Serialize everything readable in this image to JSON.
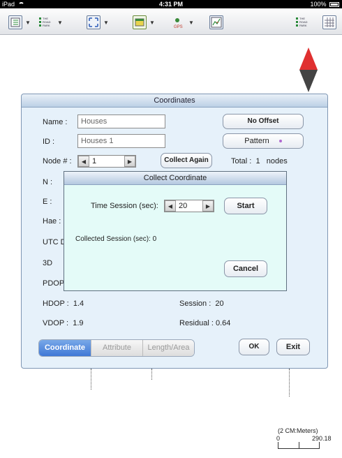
{
  "status": {
    "device": "iPad",
    "time": "4:31 PM",
    "battery": "100%"
  },
  "toolbar": {
    "mini_lines": [
      "THE",
      "ROAD",
      "PARK"
    ]
  },
  "dialog": {
    "title": "Coordinates",
    "name_label": "Name :",
    "name_value": "Houses",
    "id_label": "ID :",
    "id_value": "Houses 1",
    "node_label": "Node # :",
    "node_value": "1",
    "no_offset_button": "No Offset",
    "pattern_button": "Pattern",
    "collect_again_button": "Collect Again",
    "total_label": "Total :",
    "total_value": "1",
    "total_unit": "nodes",
    "n_label": "N :",
    "e_label": "E :",
    "hae_label": "Hae :",
    "utc_label": "UTC D",
    "threed_label": "3D",
    "pdop_label": "PDOP",
    "hdop_label": "HDOP :",
    "hdop_value": "1.4",
    "vdop_label": "VDOP :",
    "vdop_value": "1.9",
    "session_label": "Session :",
    "session_value": "20",
    "residual_label": "Residual :",
    "residual_value": "0.64",
    "tabs": [
      "Coordinate",
      "Attribute",
      "Length/Area"
    ],
    "ok_button": "OK",
    "exit_button": "Exit"
  },
  "modal": {
    "title": "Collect Coordinate",
    "time_session_label": "Time Session (sec):",
    "time_session_value": "20",
    "start_button": "Start",
    "collected_label": "Collected Session (sec): 0",
    "cancel_button": "Cancel"
  },
  "map": {
    "scale_unit": "(2 CM:Meters)",
    "scale_min": "0",
    "scale_max": "290.18"
  },
  "colors": {
    "tab_active": "#3f78d6",
    "dialog_bg": "#e6f1fa",
    "modal_bg": "#e4fbf8",
    "compass_north": "#e03030",
    "compass_south": "#444444"
  }
}
